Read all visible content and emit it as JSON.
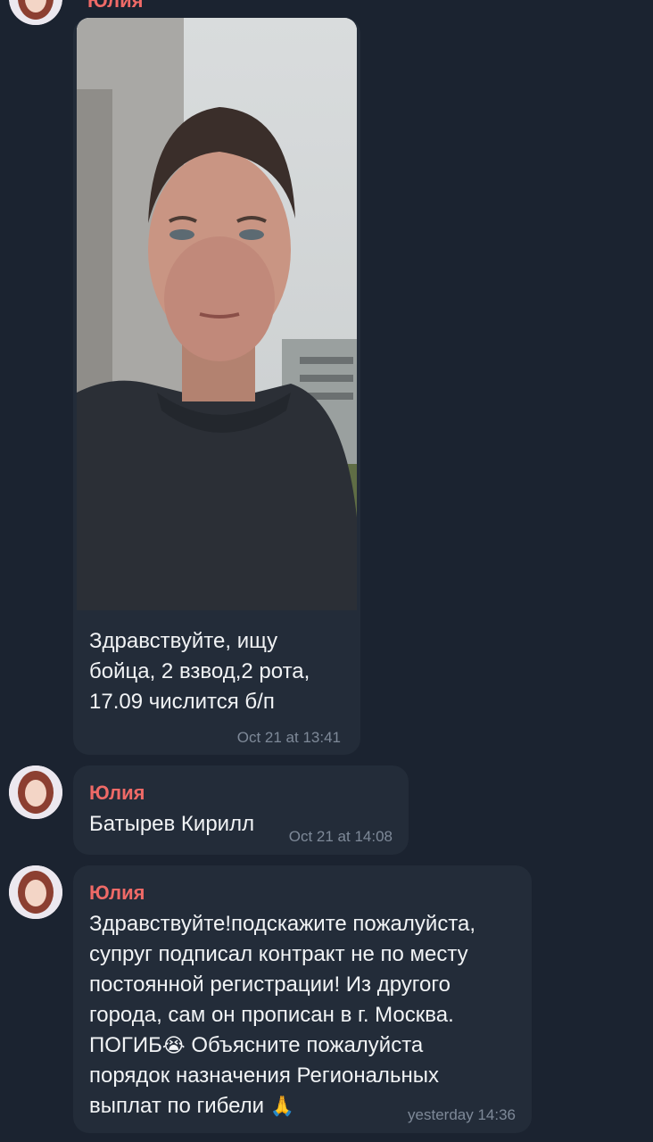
{
  "messages": [
    {
      "sender": "Юлия",
      "text_lines": [
        "Здравствуйте, ищу",
        "бойца, 2 взвод,2 рота,",
        "17.09 числится б/п"
      ],
      "time": "Oct 21 at 13:41",
      "has_photo": true
    },
    {
      "sender": "Юлия",
      "text": "Батырев Кирилл",
      "time": "Oct 21 at 14:08"
    },
    {
      "sender": "Юлия",
      "text_lines": [
        "Здравствуйте!подскажите пожалуйста,",
        "супруг подписал контракт не по месту",
        "постоянной регистрации! Из другого",
        "города, сам он прописан в г. Москва.",
        "ПОГИБ",
        "Объясните пожалуйста",
        "порядок назначения Региональных",
        "выплат по гибели"
      ],
      "emojis": [
        "😭",
        "🙏"
      ],
      "time": "yesterday 14:36"
    }
  ],
  "colors": {
    "background": "#1b2330",
    "bubble": "#232c39",
    "sender": "#ef6a67",
    "text": "#f1f3f5",
    "time": "#7e8998"
  },
  "icons": [
    "avatar-photo",
    "crying-face-emoji",
    "folded-hands-emoji"
  ]
}
